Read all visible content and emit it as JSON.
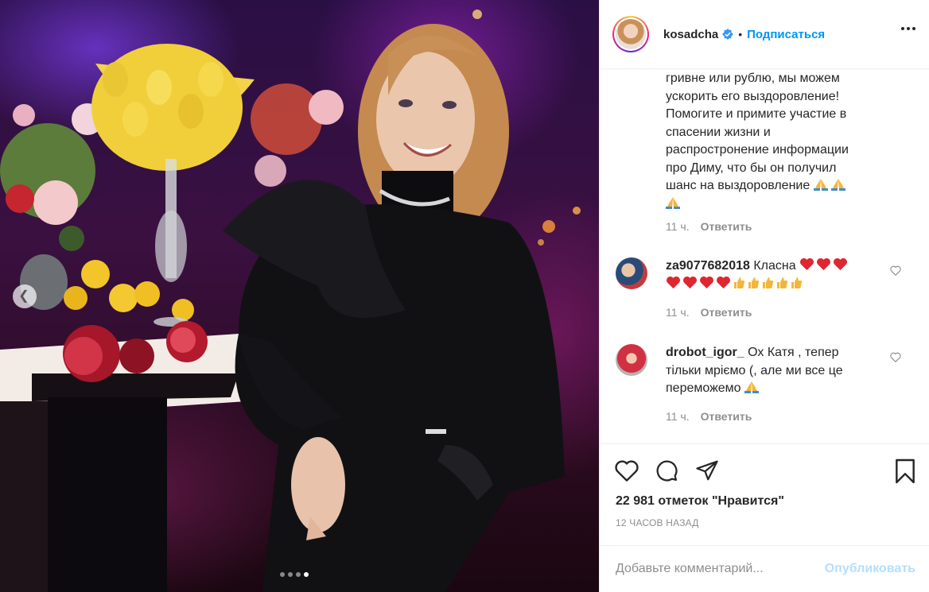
{
  "post": {
    "media_alt": "",
    "carousel_dots": 4,
    "active_dot": 3
  },
  "header": {
    "username": "kosadcha",
    "separator": "•",
    "follow_label": "Подписаться"
  },
  "caption": {
    "lines": [
      "гривне или рублю, мы можем",
      "ускорить его выздоровление!",
      "Помогите и примите участие в",
      "спасении жизни и",
      "распростронение информации",
      "про Диму, что бы он получил",
      "шанс на выздоровление"
    ],
    "time": "11 ч.",
    "reply_label": "Ответить"
  },
  "comments": [
    {
      "username": "za9077682018",
      "text": "Класна",
      "time": "11 ч.",
      "reply_label": "Ответить"
    },
    {
      "username": "drobot_igor_",
      "text_line1": "Ох Катя , тепер",
      "text_line2": "тільки мріємо (, але ми все це",
      "text_line3": "переможемо",
      "time": "11 ч.",
      "reply_label": "Ответить"
    }
  ],
  "likes": {
    "text": "22 981 отметок \"Нравится\""
  },
  "timestamp": "12 ЧАСОВ НАЗАД",
  "add_comment": {
    "placeholder": "Добавьте комментарий...",
    "post_label": "Опубликовать"
  },
  "icons": [
    "verified-icon",
    "more-icon",
    "heart-icon",
    "comment-icon",
    "share-icon",
    "bookmark-icon",
    "chevron-left-icon"
  ],
  "colors": {
    "accent": "#0095f6",
    "muted": "#8e8e8e",
    "post_disabled": "#b2dffc"
  }
}
